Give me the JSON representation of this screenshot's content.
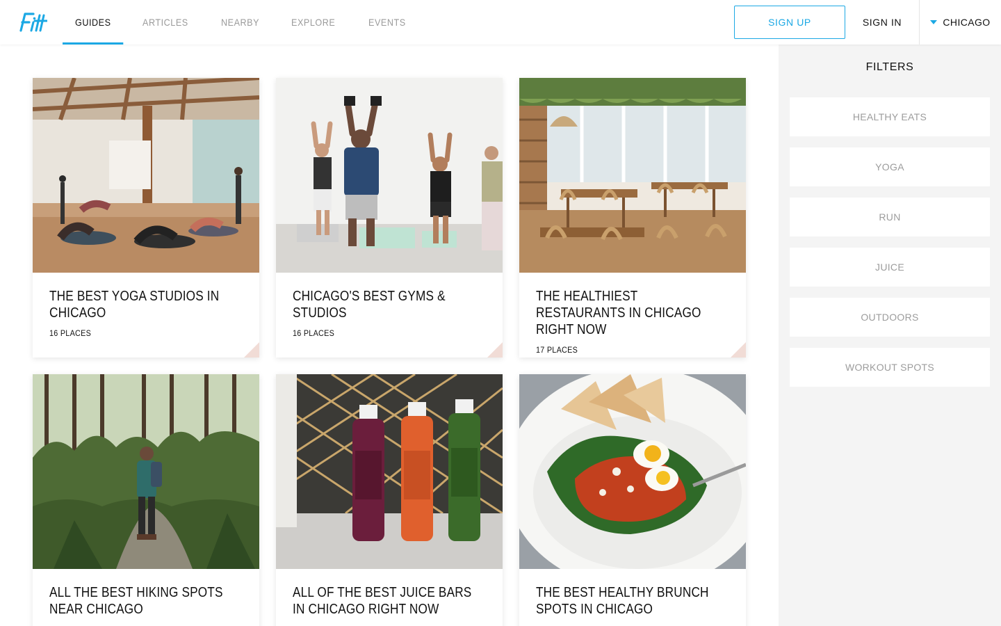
{
  "header": {
    "logo_text": "Fitt",
    "nav": [
      {
        "label": "GUIDES",
        "active": true
      },
      {
        "label": "ARTICLES",
        "active": false
      },
      {
        "label": "NEARBY",
        "active": false
      },
      {
        "label": "EXPLORE",
        "active": false
      },
      {
        "label": "EVENTS",
        "active": false
      }
    ],
    "signup_label": "SIGN UP",
    "signin_label": "SIGN IN",
    "city_label": "CHICAGO",
    "accent_color": "#1ba8e4"
  },
  "guides": [
    {
      "title": "THE BEST YOGA STUDIOS IN CHICAGO",
      "places": "16 PLACES",
      "image": "yoga-studio-photo"
    },
    {
      "title": "CHICAGO'S BEST GYMS & STUDIOS",
      "places": "16 PLACES",
      "image": "gym-class-photo"
    },
    {
      "title": "THE HEALTHIEST RESTAURANTS IN CHICAGO RIGHT NOW",
      "places": "17 PLACES",
      "image": "restaurant-interior-photo"
    },
    {
      "title": "ALL THE BEST HIKING SPOTS NEAR CHICAGO",
      "places": "",
      "image": "forest-hiker-photo"
    },
    {
      "title": "ALL OF THE BEST JUICE BARS IN CHICAGO RIGHT NOW",
      "places": "",
      "image": "juice-bottles-photo"
    },
    {
      "title": "THE BEST HEALTHY BRUNCH SPOTS IN CHICAGO",
      "places": "",
      "image": "brunch-dish-photo"
    }
  ],
  "sidebar": {
    "title": "FILTERS",
    "filters": [
      "HEALTHY EATS",
      "YOGA",
      "RUN",
      "JUICE",
      "OUTDOORS",
      "WORKOUT SPOTS"
    ]
  }
}
